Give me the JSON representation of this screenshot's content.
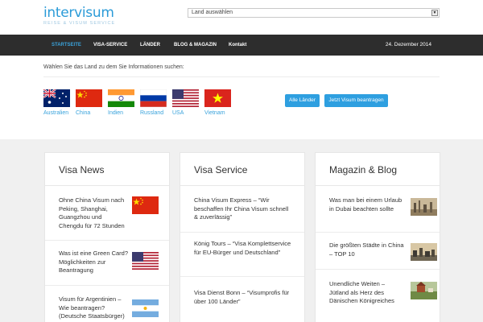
{
  "header": {
    "logo_name": "intervisum",
    "logo_tagline": "REISE & VISUM SERVICE",
    "country_select_value": "Land auswählen"
  },
  "nav": {
    "items": [
      "Startseite",
      "Visa-Service",
      "Länder",
      "Blog & Magazin",
      "Kontakt"
    ],
    "active": "Startseite",
    "date": "24. Dezember 2014"
  },
  "picker": {
    "prompt": "Wählen Sie das Land zu dem Sie Informationen suchen:",
    "countries": [
      {
        "label": "Australien",
        "icon": "flag-australia-icon"
      },
      {
        "label": "China",
        "icon": "flag-china-icon"
      },
      {
        "label": "Indien",
        "icon": "flag-india-icon"
      },
      {
        "label": "Russland",
        "icon": "flag-russia-icon"
      },
      {
        "label": "USA",
        "icon": "flag-usa-icon"
      },
      {
        "label": "Vietnam",
        "icon": "flag-vietnam-icon"
      }
    ],
    "all_countries_button": "Alle Länder",
    "apply_button": "Jetzt Visum beantragen"
  },
  "sections": [
    {
      "title": "Visa News",
      "items": [
        {
          "text": "Ohne China Visum nach Peking, Shanghai, Guangzhou und Chengdu für 72 Stunden",
          "icon": "flag-china-icon"
        },
        {
          "text": "Was ist eine Green Card? Möglichkeiten zur Beantragung",
          "icon": "flag-usa-icon"
        },
        {
          "text": "Visum für Argentinien – Wie beantragen? (Deutsche Staatsbürger)",
          "icon": "flag-argentina-icon"
        }
      ]
    },
    {
      "title": "Visa Service",
      "items": [
        {
          "text": "China Visum Express – “Wir beschaffen Ihr China Visum schnell & zuverlässig”"
        },
        {
          "text": "König Tours – “Visa Komplettservice für EU-Bürger und Deutschland”"
        },
        {
          "text": "Visa Dienst Bonn – “Visumprofis für über 100 Länder”"
        }
      ]
    },
    {
      "title": "Magazin & Blog",
      "items": [
        {
          "text": "Was man bei einem Urlaub in Dubai beachten sollte",
          "icon": "dubai-skyline-photo"
        },
        {
          "text": "Die größten Städte in China – TOP 10",
          "icon": "china-city-photo"
        },
        {
          "text": "Unendliche Weiten – Jütland als Herz des Dänischen Königreiches",
          "icon": "jutland-landscape-photo"
        }
      ]
    }
  ],
  "colors": {
    "accent": "#2e9fe0",
    "nav_bg": "#2d2d2d",
    "content_bg": "#f0f0f0"
  }
}
